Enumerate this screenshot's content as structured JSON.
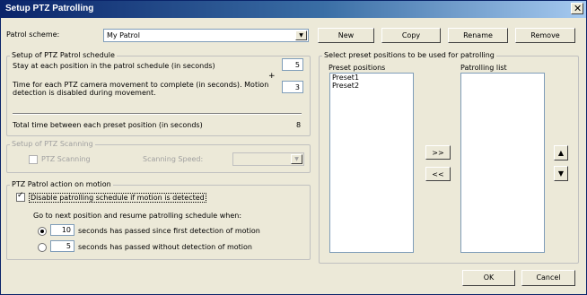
{
  "window": {
    "title": "Setup PTZ Patrolling"
  },
  "patrol": {
    "label": "Patrol scheme:",
    "value": "My Patrol",
    "buttons": {
      "new": "New",
      "copy": "Copy",
      "rename": "Rename",
      "remove": "Remove"
    }
  },
  "schedule": {
    "title": "Setup of PTZ Patrol schedule",
    "stay_label": "Stay at each position in the patrol schedule (in seconds)",
    "stay_value": "5",
    "plus": "+",
    "move_label_1": "Time for each PTZ camera movement to complete (in seconds). Motion",
    "move_label_2": "detection is disabled during movement.",
    "move_value": "3",
    "total_label": "Total time between each preset position (in seconds)",
    "total_value": "8"
  },
  "scanning": {
    "title": "Setup of PTZ Scanning",
    "checkbox_label": "PTZ Scanning",
    "speed_label": "Scanning Speed:"
  },
  "motion": {
    "title": "PTZ Patrol action on motion",
    "disable_label": "Disable patrolling schedule if motion is detected",
    "goto_label": "Go to next position and resume patrolling schedule when:",
    "opt1_value": "10",
    "opt1_label": "seconds has passed since first detection of motion",
    "opt2_value": "5",
    "opt2_label": "seconds has passed without detection of motion"
  },
  "presets": {
    "title": "Select preset positions to be used for patrolling",
    "positions_label": "Preset positions",
    "positions": [
      "Preset1",
      "Preset2"
    ],
    "list_label": "Patrolling list",
    "add": ">>",
    "remove": "<<",
    "up": "▲",
    "down": "▼"
  },
  "footer": {
    "ok": "OK",
    "cancel": "Cancel"
  }
}
